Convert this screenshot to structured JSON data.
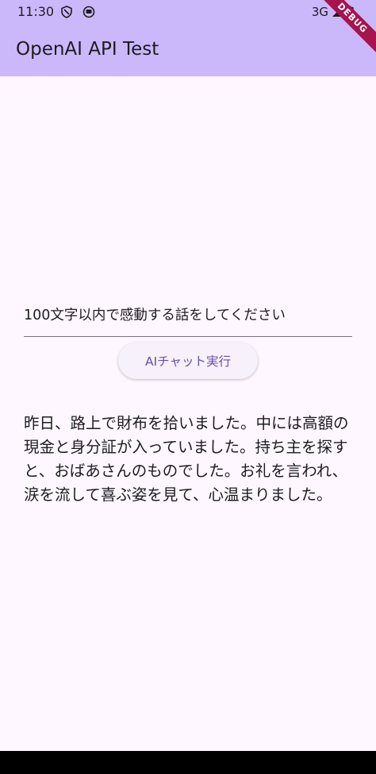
{
  "status_bar": {
    "time": "11:30",
    "network": "3G",
    "icons": [
      "shield-icon",
      "sync-icon",
      "signal-icon",
      "battery-icon"
    ]
  },
  "app_bar": {
    "title": "OpenAI API Test",
    "debug_banner": "DEBUG"
  },
  "prompt": {
    "value": "100文字以内で感動する話をしてください"
  },
  "chat_button": {
    "label": "AIチャット実行"
  },
  "response": {
    "text": "昨日、路上で財布を拾いました。中には高額の現金と身分証が入っていました。持ち主を探すと、おばあさんのものでした。お礼を言われ、涙を流して喜ぶ姿を見て、心温まりました。"
  },
  "colors": {
    "app_bar": "#cbb8fa",
    "background": "#fef7ff",
    "button_text": "#6750a4",
    "debug_ribbon": "#a6134d"
  }
}
